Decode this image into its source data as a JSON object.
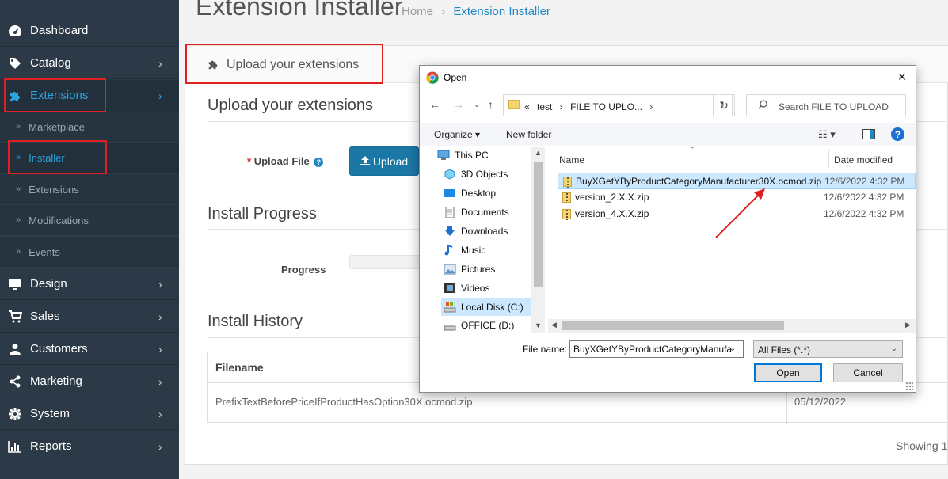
{
  "sidebar": {
    "items": [
      {
        "label": "Dashboard",
        "icon": "dashboard-icon"
      },
      {
        "label": "Catalog",
        "icon": "tag-icon"
      },
      {
        "label": "Extensions",
        "icon": "puzzle-icon"
      },
      {
        "label": "Design",
        "icon": "monitor-icon"
      },
      {
        "label": "Sales",
        "icon": "cart-icon"
      },
      {
        "label": "Customers",
        "icon": "user-icon"
      },
      {
        "label": "Marketing",
        "icon": "share-icon"
      },
      {
        "label": "System",
        "icon": "gear-icon"
      },
      {
        "label": "Reports",
        "icon": "bar-chart-icon"
      }
    ],
    "sub_items": [
      {
        "label": "Marketplace"
      },
      {
        "label": "Installer"
      },
      {
        "label": "Extensions"
      },
      {
        "label": "Modifications"
      },
      {
        "label": "Events"
      }
    ]
  },
  "page": {
    "title": "Extension Installer",
    "breadcrumb_home": "Home",
    "breadcrumb_sep": "›",
    "breadcrumb_current": "Extension Installer",
    "panel_heading": "Upload your extensions",
    "upload_section": "Upload your extensions",
    "required_mark": "*",
    "upload_file_label": "Upload File",
    "upload_button": "Upload",
    "install_progress": "Install Progress",
    "progress_label": "Progress",
    "install_history": "Install History",
    "history_col_filename": "Filename",
    "history_row_filename": "PrefixTextBeforePriceIfProductHasOption30X.ocmod.zip",
    "history_row_date": "05/12/2022",
    "showing": "Showing 1"
  },
  "dialog": {
    "title": "Open",
    "address_prefix": "«",
    "address_path1": "test",
    "address_sep": "›",
    "address_path2": "FILE TO UPLO...",
    "search_placeholder": "Search FILE TO UPLOAD",
    "organize": "Organize ▾",
    "new_folder": "New folder",
    "help": "?",
    "tree": [
      {
        "label": "This PC",
        "icon": "computer-icon"
      },
      {
        "label": "3D Objects",
        "icon": "cube-icon"
      },
      {
        "label": "Desktop",
        "icon": "desktop-icon"
      },
      {
        "label": "Documents",
        "icon": "documents-icon"
      },
      {
        "label": "Downloads",
        "icon": "download-icon"
      },
      {
        "label": "Music",
        "icon": "music-icon"
      },
      {
        "label": "Pictures",
        "icon": "pictures-icon"
      },
      {
        "label": "Videos",
        "icon": "video-icon"
      },
      {
        "label": "Local Disk (C:)",
        "icon": "disk-icon"
      },
      {
        "label": "OFFICE (D:)",
        "icon": "disk-icon"
      }
    ],
    "col_name": "Name",
    "col_date": "Date modified",
    "files": [
      {
        "name": "BuyXGetYByProductCategoryManufacturer30X.ocmod.zip",
        "date": "12/6/2022 4:32 PM"
      },
      {
        "name": "version_2.X.X.zip",
        "date": "12/6/2022 4:32 PM"
      },
      {
        "name": "version_4.X.X.zip",
        "date": "12/6/2022 4:32 PM"
      }
    ],
    "file_name_label": "File name:",
    "file_name_value": "BuyXGetYByProductCategoryManufa",
    "file_type": "All Files (*.*)",
    "open_button": "Open",
    "cancel_button": "Cancel"
  },
  "colors": {
    "sidebar_bg": "#2b3a46",
    "accent": "#2aa3e0",
    "highlight_red": "#e02020",
    "upload_btn": "#1b78a6"
  }
}
